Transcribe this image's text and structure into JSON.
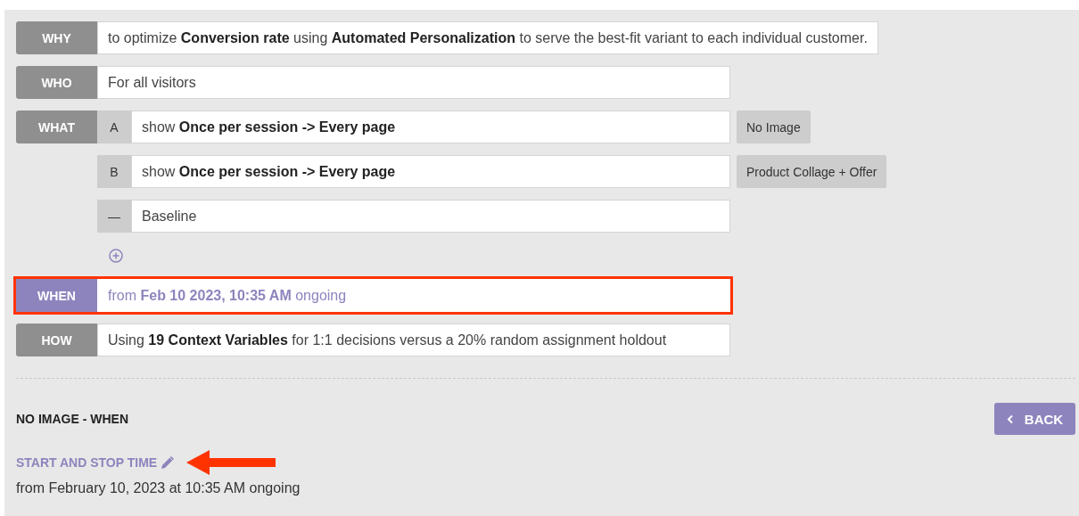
{
  "criteria": [
    {
      "label": "WHY",
      "kind": "text",
      "selected": false,
      "highlighted": false,
      "text": "to optimize **Conversion rate** using **Automated Personalization** to serve the best-fit variant to each individual customer."
    },
    {
      "label": "WHO",
      "kind": "text",
      "selected": false,
      "highlighted": false,
      "text": "For all visitors"
    },
    {
      "label": "WHAT",
      "kind": "variants",
      "selected": false,
      "highlighted": false,
      "variants": [
        {
          "key": "A",
          "text": "show **Once per session -> Every page**",
          "tag": "No Image"
        },
        {
          "key": "B",
          "text": "show **Once per session -> Every page**",
          "tag": "Product Collage + Offer"
        },
        {
          "key": "—",
          "text": "Baseline"
        }
      ]
    },
    {
      "label": "WHEN",
      "kind": "text",
      "selected": true,
      "highlighted": true,
      "text": "from **Feb 10 2023, 10:35 AM** ongoing"
    },
    {
      "label": "HOW",
      "kind": "text",
      "selected": false,
      "highlighted": false,
      "text": "Using **19 Context Variables** for 1:1 decisions versus a 20% random assignment holdout"
    }
  ],
  "detail": {
    "title": "NO IMAGE - WHEN",
    "back_button": "BACK",
    "section_label": "START AND STOP TIME",
    "annotated": true,
    "value": "from February 10, 2023 at 10:35 AM ongoing"
  }
}
